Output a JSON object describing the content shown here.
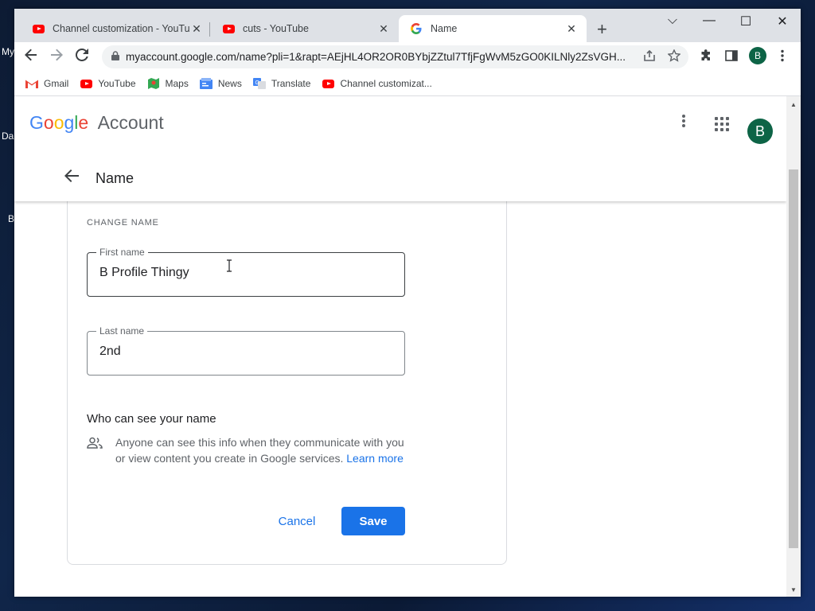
{
  "desktop": {
    "labels": [
      "My",
      "Da",
      "B"
    ]
  },
  "tabs": [
    {
      "title": "Channel customization - YouTube",
      "icon": "youtube-icon",
      "close": "✕"
    },
    {
      "title": "cuts - YouTube",
      "icon": "youtube-icon",
      "close": "✕"
    },
    {
      "title": "Name",
      "icon": "google-icon",
      "close": "✕",
      "active": true
    }
  ],
  "new_tab": "+",
  "window_controls": {
    "dropdown": "⌵",
    "minimize": "—",
    "maximize": "☐",
    "close": "✕"
  },
  "toolbar": {
    "url": "myaccount.google.com/name?pli=1&rapt=AEjHL4OR2OR0BYbjZZtul7TfjFgWvM5zGO0KILNly2ZsVGH...",
    "profile_initial": "B"
  },
  "bookmarks": [
    {
      "label": "Gmail",
      "icon": "gmail-icon"
    },
    {
      "label": "YouTube",
      "icon": "youtube-icon"
    },
    {
      "label": "Maps",
      "icon": "maps-icon"
    },
    {
      "label": "News",
      "icon": "news-icon"
    },
    {
      "label": "Translate",
      "icon": "translate-icon"
    },
    {
      "label": "Channel customizat...",
      "icon": "youtube-icon"
    }
  ],
  "header": {
    "logo_google": "Google",
    "logo_account": "Account",
    "avatar_initial": "B",
    "page_title": "Name"
  },
  "form": {
    "section_label": "CHANGE NAME",
    "first_name": {
      "label": "First name",
      "value": "B Profile Thingy"
    },
    "last_name": {
      "label": "Last name",
      "value": "2nd"
    },
    "visibility_heading": "Who can see your name",
    "visibility_text": "Anyone can see this info when they communicate with you or view content you create in Google services.",
    "learn_more": "Learn more",
    "cancel_label": "Cancel",
    "save_label": "Save"
  },
  "colors": {
    "accent": "#1a73e8",
    "avatar": "#0d6446",
    "youtube": "#ff0000"
  }
}
